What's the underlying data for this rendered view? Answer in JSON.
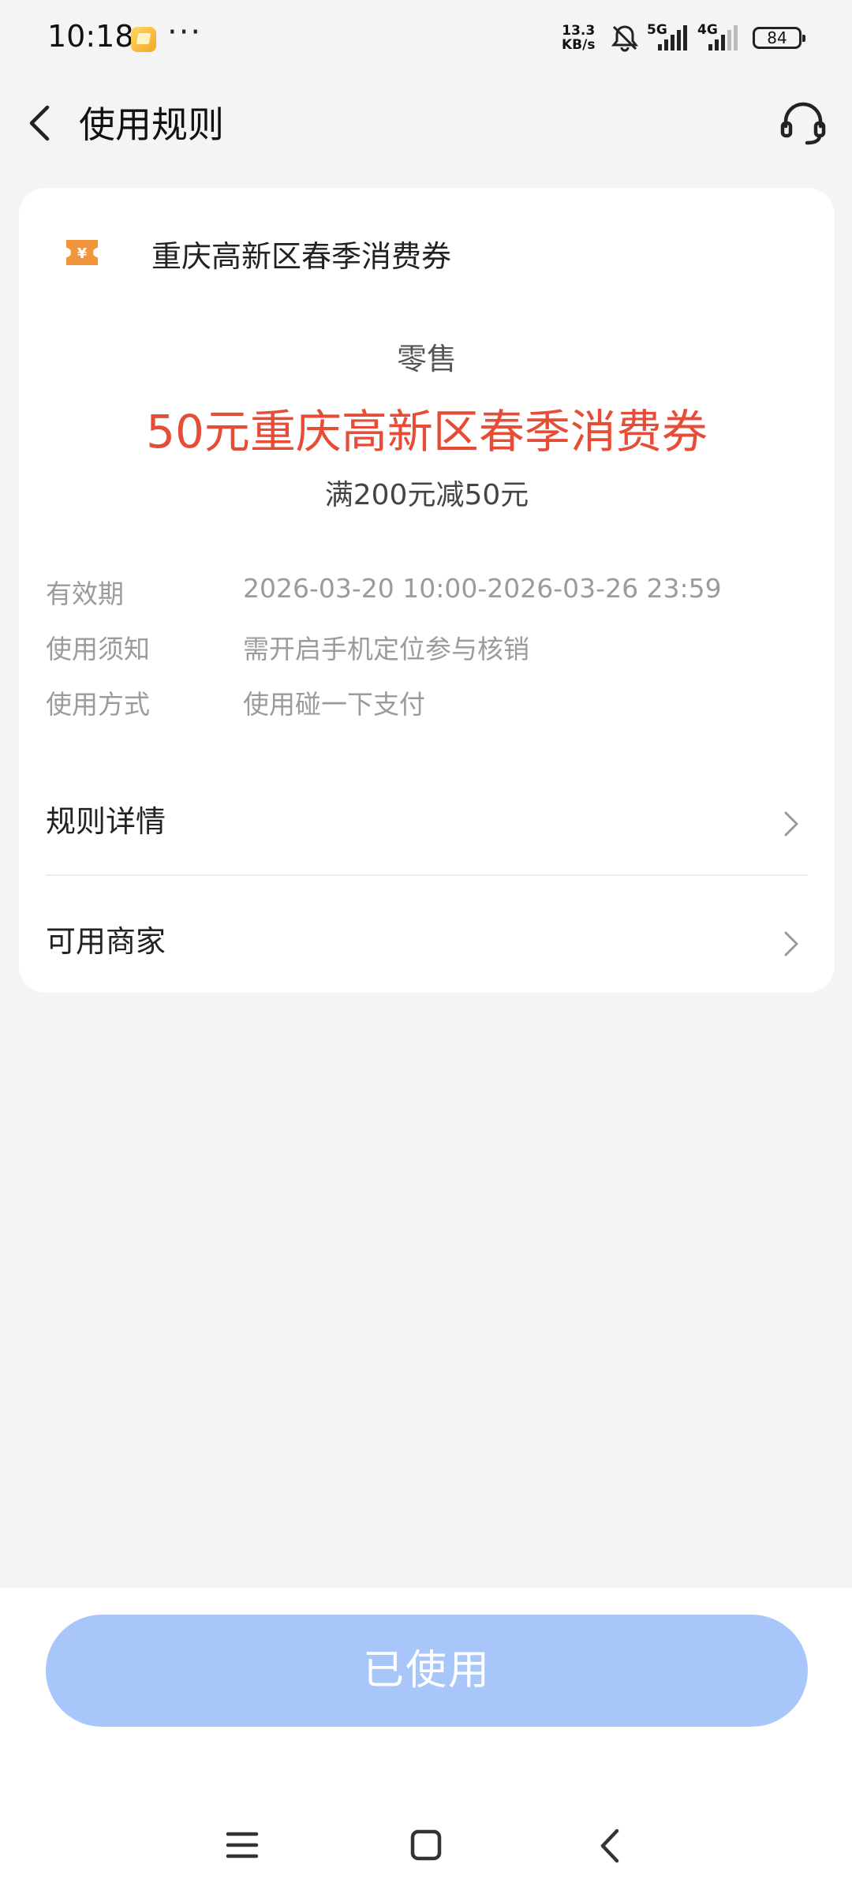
{
  "status_bar": {
    "time": "10:18",
    "more": "···",
    "net_speed_value": "13.3",
    "net_speed_unit": "KB/s",
    "net1": "5G",
    "net2": "4G",
    "battery": "84",
    "icons": [
      "notification-app-icon",
      "mute-bell-icon",
      "signal-icon",
      "battery-icon"
    ]
  },
  "header": {
    "title": "使用规则",
    "back_icon": "back-arrow-icon",
    "service_icon": "headset-icon"
  },
  "coupon": {
    "name": "重庆高新区春季消费券",
    "icon": "coupon-ticket-icon",
    "icon_color": "#f0953a",
    "category": "零售",
    "title": "50元重庆高新区春季消费券",
    "title_color": "#e74c37",
    "condition": "满200元减50元"
  },
  "info": [
    {
      "label": "有效期",
      "value": "2026-03-20 10:00-2026-03-26 23:59"
    },
    {
      "label": "使用须知",
      "value": "需开启手机定位参与核销"
    },
    {
      "label": "使用方式",
      "value": "使用碰一下支付"
    }
  ],
  "links": [
    {
      "label": "规则详情"
    },
    {
      "label": "可用商家"
    }
  ],
  "bottom": {
    "button_label": "已使用",
    "button_color": "#a9c6fa"
  },
  "nav_bar": {
    "icons": [
      "menu-icon",
      "home-icon",
      "back-icon"
    ]
  }
}
